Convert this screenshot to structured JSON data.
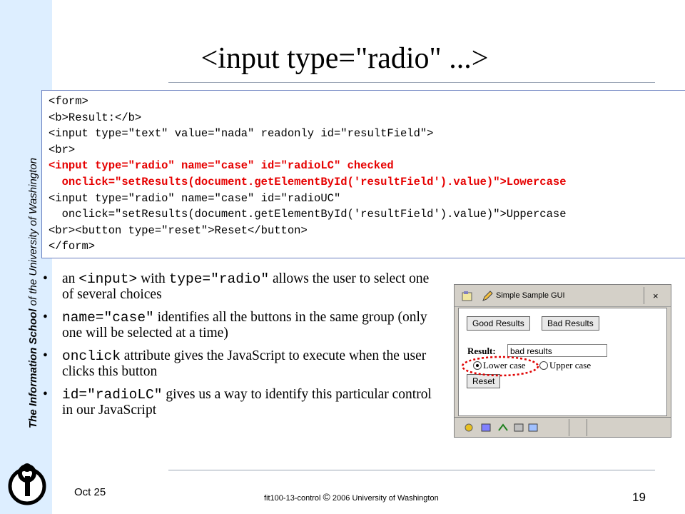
{
  "sidebar": {
    "text_bold": "The Information School",
    "text_rest": " of  the University of Washington"
  },
  "title": "<input type=\"radio\" ...>",
  "code": {
    "line1": "<form>",
    "line2": "<b>Result:</b>",
    "line3": "<input type=\"text\" value=\"nada\" readonly id=\"resultField\">",
    "line4": "<br>",
    "line5": "<input type=\"radio\" name=\"case\" id=\"radioLC\" checked",
    "line6": "  onclick=\"setResults(document.getElementById('resultField').value)\">Lowercase",
    "line7": "<input type=\"radio\" name=\"case\" id=\"radioUC\"",
    "line8": "  onclick=\"setResults(document.getElementById('resultField').value)\">Uppercase",
    "line9": "<br><button type=\"reset\">Reset</button>",
    "line10": "</form>"
  },
  "bullets": {
    "b1_pre": "an ",
    "b1_code1": "<input>",
    "b1_mid": " with ",
    "b1_code2": "type=\"radio\"",
    "b1_post": " allows the user to select one of several choices",
    "b2_code": "name=\"case\"",
    "b2_post": " identifies all the buttons in the same group (only one will be selected at a time)",
    "b3_code": "onclick",
    "b3_post": " attribute gives the JavaScript to execute when the user clicks this button",
    "b4_code": "id=\"radioLC\"",
    "b4_post": " gives us a way to identify this particular control in our JavaScript"
  },
  "screenshot": {
    "window_title": "Simple Sample GUI",
    "close_label": "×",
    "good_button": "Good Results",
    "bad_button": "Bad Results",
    "result_label": "Result:",
    "result_value": "bad results",
    "lower_label": "Lower case",
    "upper_label": "Upper case",
    "reset_button": "Reset"
  },
  "footer": {
    "date": "Oct 25",
    "center_pre": "fit100-13-control ",
    "copyright": "©",
    "center_post": " 2006 University of Washington",
    "page_number": "19"
  },
  "colors": {
    "sidebar_bg": "#ddeeff",
    "highlight_code": "#e60000",
    "code_border": "#6a7fc0",
    "annotation_circle": "#e00000"
  }
}
